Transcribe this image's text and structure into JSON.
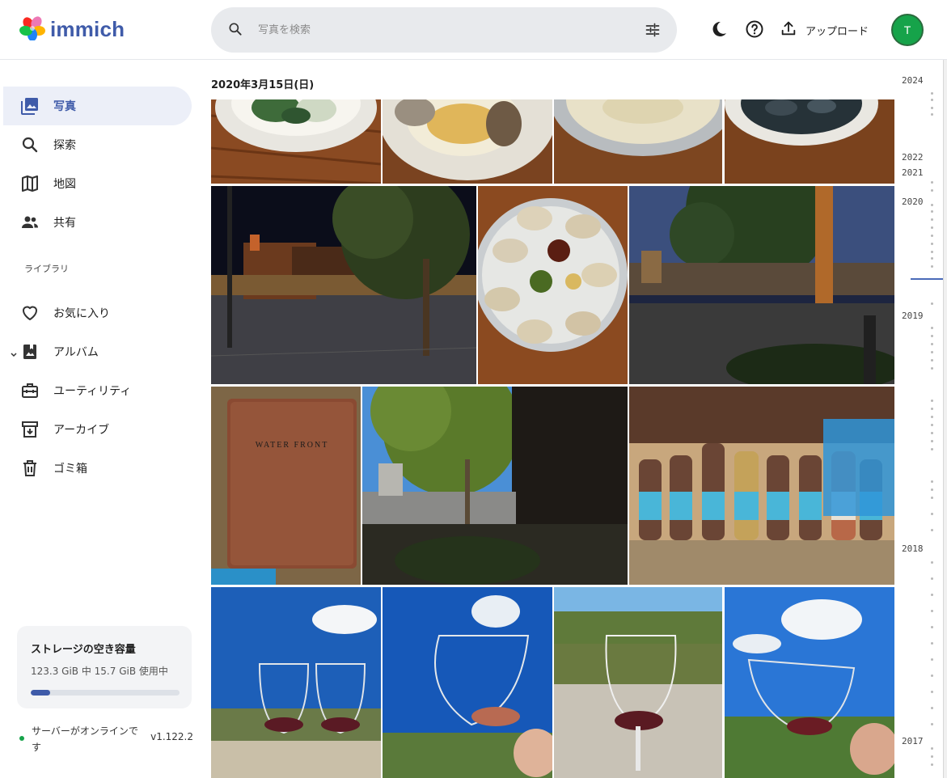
{
  "app": {
    "name": "immich"
  },
  "header": {
    "search_placeholder": "写真を検索",
    "upload_label": "アップロード",
    "avatar_initial": "T"
  },
  "sidebar": {
    "items": [
      {
        "label": "写真",
        "icon": "photos-icon",
        "active": true
      },
      {
        "label": "探索",
        "icon": "search-icon"
      },
      {
        "label": "地図",
        "icon": "map-icon"
      },
      {
        "label": "共有",
        "icon": "people-icon"
      }
    ],
    "library_label": "ライブラリ",
    "library_items": [
      {
        "label": "お気に入り",
        "icon": "heart-icon"
      },
      {
        "label": "アルバム",
        "icon": "album-icon"
      },
      {
        "label": "ユーティリティ",
        "icon": "toolbox-icon"
      },
      {
        "label": "アーカイブ",
        "icon": "archive-icon"
      },
      {
        "label": "ゴミ箱",
        "icon": "trash-icon"
      }
    ],
    "storage": {
      "title": "ストレージの空き容量",
      "usage": "123.3 GiB 中 15.7 GiB 使用中",
      "used_fraction": 0.13
    },
    "server": {
      "status": "サーバーがオンラインです",
      "version": "v1.122.2"
    }
  },
  "main": {
    "date_group": "2020年3月15日(日)"
  },
  "timeline": {
    "years": [
      "2024",
      "2022",
      "2021",
      "2020",
      "2019",
      "2018",
      "2017"
    ]
  },
  "colors": {
    "accent": "#3f5ba9",
    "online": "#16a34a",
    "active_bg": "#eceff8"
  }
}
